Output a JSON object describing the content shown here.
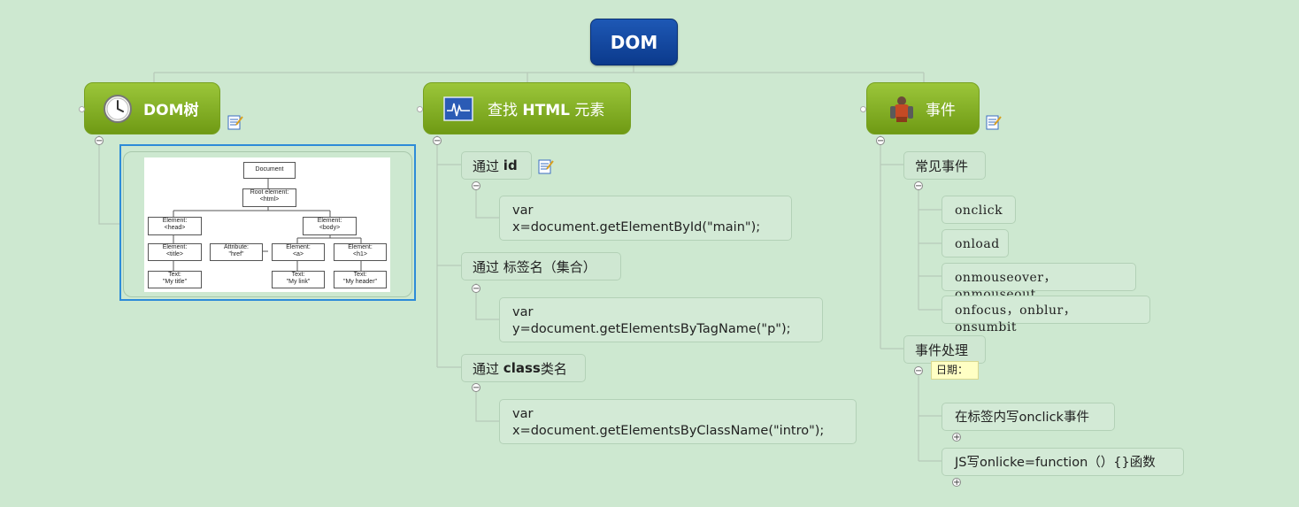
{
  "root": {
    "label": "DOM"
  },
  "branches": {
    "dom_tree": {
      "label": "DOM树",
      "image": {
        "document": "Document",
        "root_element": [
          "Root element:",
          "<html>"
        ],
        "head": [
          "Element:",
          "<head>"
        ],
        "body": [
          "Element:",
          "<body>"
        ],
        "title": [
          "Element:",
          "<title>"
        ],
        "attribute": [
          "Attribute:",
          "\"href\""
        ],
        "a": [
          "Element:",
          "<a>"
        ],
        "h1": [
          "Element:",
          "<h1>"
        ],
        "text_title": [
          "Text:",
          "\"My title\""
        ],
        "text_link": [
          "Text:",
          "\"My link\""
        ],
        "text_header": [
          "Text:",
          "\"My header\""
        ]
      }
    },
    "find": {
      "label_pre": "查找",
      "label_bold": "HTML",
      "label_post": "元素",
      "items": [
        {
          "pre": "通过",
          "bold": "id",
          "post": "",
          "code": [
            "var",
            "x=document.getElementById(\"main\");"
          ]
        },
        {
          "pre": "通过 标签名（集合）",
          "bold": "",
          "post": "",
          "code": [
            "var",
            "y=document.getElementsByTagName(\"p\");"
          ]
        },
        {
          "pre": "通过",
          "bold": "class",
          "post": "类名",
          "code": [
            "var",
            "x=document.getElementsByClassName(\"intro\");"
          ]
        }
      ]
    },
    "events": {
      "label": "事件",
      "common": {
        "label": "常见事件",
        "items": [
          "onclick",
          "onload",
          "onmouseover，onmouseout",
          "onfocus，onblur，onsumbit"
        ]
      },
      "handling": {
        "label": "事件处理",
        "date_label": "日期：",
        "items": [
          "在标签内写onclick事件",
          "JS写onlicke=function（）{}函数"
        ]
      }
    }
  },
  "colors": {
    "background": "#cde8d0",
    "root": "#0b3a8c",
    "branch": "#7ea91e",
    "connector": "#b8c8ba",
    "selection": "#2d8bd8"
  }
}
